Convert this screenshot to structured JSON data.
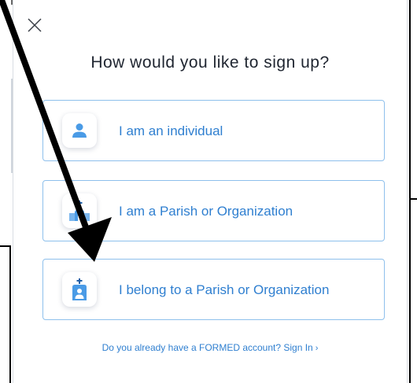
{
  "modal": {
    "title": "How would you like to sign up?",
    "close_icon": "close-icon",
    "options": [
      {
        "label": "I am an individual",
        "icon": "person-icon"
      },
      {
        "label": "I am a Parish or Organization",
        "icon": "church-building-icon"
      },
      {
        "label": "I belong to a Parish or Organization",
        "icon": "parish-member-icon"
      }
    ],
    "signin": {
      "text": "Do you already have a FORMED account? Sign In",
      "chevron": "›"
    }
  },
  "colors": {
    "accent": "#2f7fd0",
    "option_border": "#8ec0ec",
    "title_text": "#1f2530",
    "icon_blue": "#4a9be6"
  }
}
